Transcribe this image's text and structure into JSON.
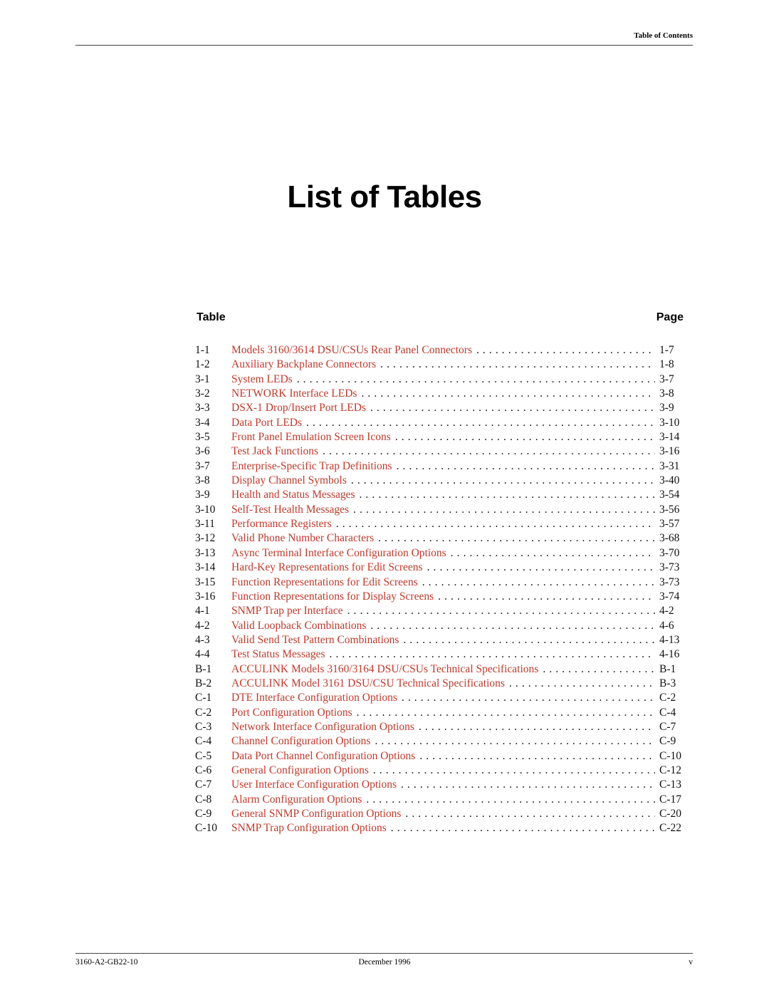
{
  "header": {
    "running_head": "Table of Contents"
  },
  "title": "List of Tables",
  "columns": {
    "table": "Table",
    "page": "Page"
  },
  "link_color": "#c0392b",
  "entries": [
    {
      "num": "1-1",
      "title": "Models 3160/3614 DSU/CSUs Rear Panel Connectors",
      "page": "1-7"
    },
    {
      "num": "1-2",
      "title": "Auxiliary Backplane Connectors",
      "page": "1-8"
    },
    {
      "num": "3-1",
      "title": "System LEDs",
      "page": "3-7"
    },
    {
      "num": "3-2",
      "title": "NETWORK Interface LEDs",
      "page": "3-8"
    },
    {
      "num": "3-3",
      "title": "DSX-1 Drop/Insert Port LEDs",
      "page": "3-9"
    },
    {
      "num": "3-4",
      "title": "Data Port LEDs",
      "page": "3-10"
    },
    {
      "num": "3-5",
      "title": "Front Panel Emulation Screen Icons",
      "page": "3-14"
    },
    {
      "num": "3-6",
      "title": "Test Jack Functions",
      "page": "3-16"
    },
    {
      "num": "3-7",
      "title": "Enterprise-Specific Trap Definitions",
      "page": "3-31"
    },
    {
      "num": "3-8",
      "title": "Display Channel Symbols",
      "page": "3-40"
    },
    {
      "num": "3-9",
      "title": "Health and Status Messages",
      "page": "3-54"
    },
    {
      "num": "3-10",
      "title": "Self-Test Health Messages",
      "page": "3-56"
    },
    {
      "num": "3-11",
      "title": "Performance Registers",
      "page": "3-57"
    },
    {
      "num": "3-12",
      "title": "Valid Phone Number Characters",
      "page": "3-68"
    },
    {
      "num": "3-13",
      "title": "Async Terminal Interface Configuration Options",
      "page": "3-70"
    },
    {
      "num": "3-14",
      "title": "Hard-Key Representations for Edit Screens",
      "page": "3-73"
    },
    {
      "num": "3-15",
      "title": "Function Representations for Edit Screens",
      "page": "3-73"
    },
    {
      "num": "3-16",
      "title": "Function Representations for Display Screens",
      "page": "3-74"
    },
    {
      "num": "4-1",
      "title": "SNMP Trap per Interface",
      "page": "4-2"
    },
    {
      "num": "4-2",
      "title": "Valid Loopback Combinations",
      "page": "4-6"
    },
    {
      "num": "4-3",
      "title": "Valid Send Test Pattern Combinations",
      "page": "4-13"
    },
    {
      "num": "4-4",
      "title": "Test Status Messages",
      "page": "4-16"
    },
    {
      "num": "B-1",
      "title": "ACCULINK Models 3160/3164 DSU/CSUs Technical Specifications",
      "page": "B-1"
    },
    {
      "num": "B-2",
      "title": "ACCULINK Model 3161 DSU/CSU Technical Specifications",
      "page": "B-3"
    },
    {
      "num": "C-1",
      "title": "DTE Interface Configuration Options",
      "page": "C-2"
    },
    {
      "num": "C-2",
      "title": "Port Configuration Options",
      "page": "C-4"
    },
    {
      "num": "C-3",
      "title": "Network Interface Configuration Options",
      "page": "C-7"
    },
    {
      "num": "C-4",
      "title": "Channel Configuration Options",
      "page": "C-9"
    },
    {
      "num": "C-5",
      "title": "Data Port Channel Configuration Options",
      "page": "C-10"
    },
    {
      "num": "C-6",
      "title": "General Configuration Options",
      "page": "C-12"
    },
    {
      "num": "C-7",
      "title": "User Interface Configuration Options",
      "page": "C-13"
    },
    {
      "num": "C-8",
      "title": "Alarm Configuration Options",
      "page": "C-17"
    },
    {
      "num": "C-9",
      "title": "General SNMP Configuration Options",
      "page": "C-20"
    },
    {
      "num": "C-10",
      "title": "SNMP Trap Configuration Options",
      "page": "C-22"
    }
  ],
  "footer": {
    "doc_number": "3160-A2-GB22-10",
    "date": "December 1996",
    "page_number": "v"
  }
}
